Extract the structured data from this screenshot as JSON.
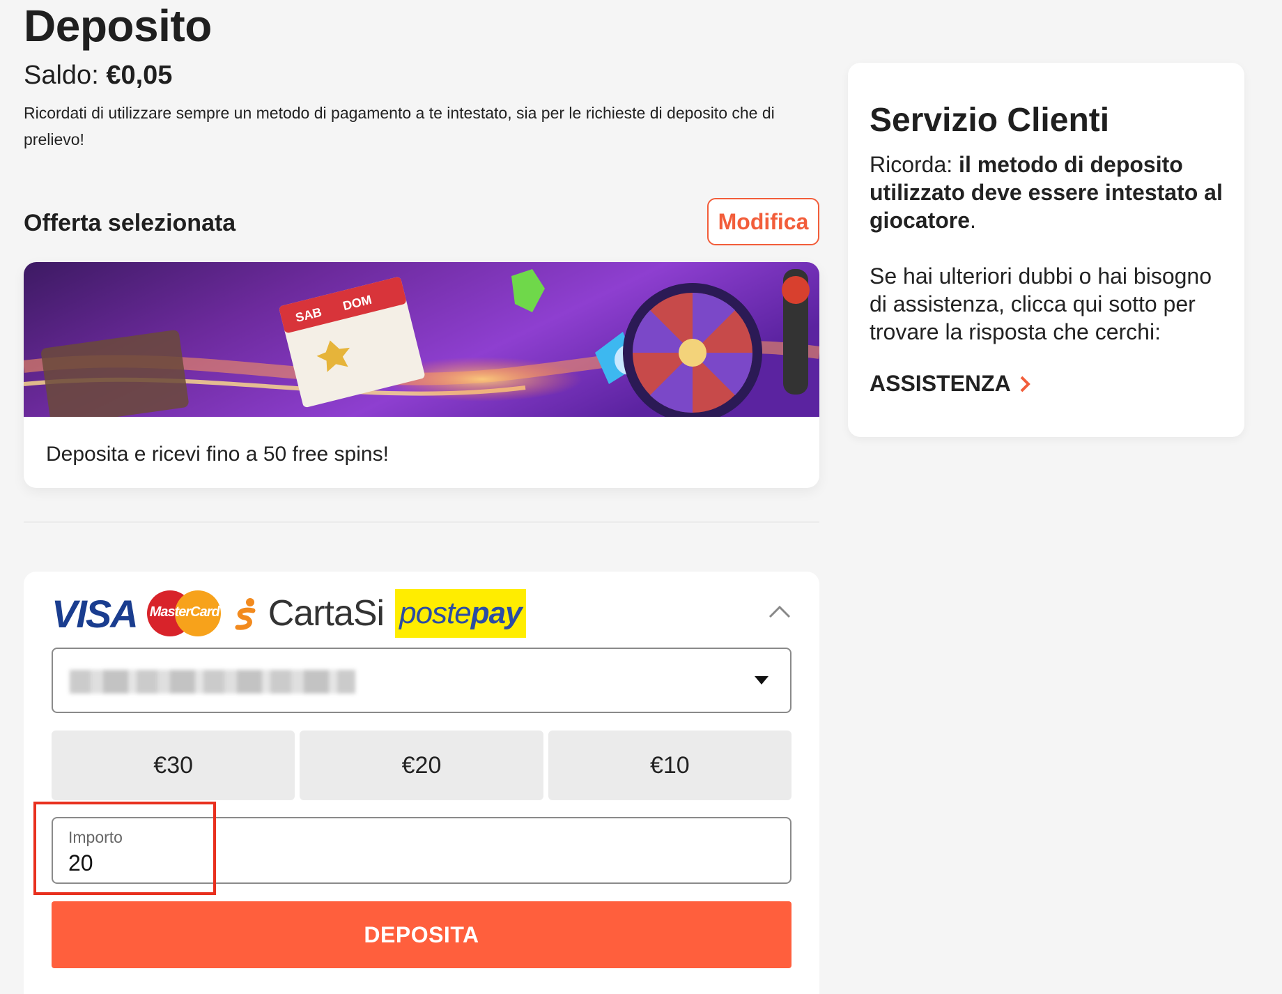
{
  "page": {
    "title": "Deposito",
    "balance_label": "Saldo:",
    "balance_value": "€0,05",
    "reminder": "Ricordati di utilizzare sempre un metodo di pagamento a te intestato, sia per le richieste di deposito che di prelievo!"
  },
  "offer": {
    "heading": "Offerta selezionata",
    "modify_label": "Modifica",
    "banner_calendar_days": [
      "SAB",
      "DOM"
    ],
    "description": "Deposita e ricevi fino a 50 free spins!"
  },
  "payment": {
    "logos": {
      "visa": "VISA",
      "mastercard": "MasterCard",
      "cartasi": "CartaSi",
      "postepay_a": "poste",
      "postepay_b": "pay"
    },
    "card_select_value": "",
    "amount_options": [
      "€30",
      "€20",
      "€10"
    ],
    "amount_label": "Importo",
    "amount_value": "20",
    "deposit_label": "DEPOSITA"
  },
  "support": {
    "title": "Servizio Clienti",
    "p1_prefix": "Ricorda: ",
    "p1_bold": "il metodo di deposito utilizzato deve essere intestato al giocatore",
    "p1_suffix": ".",
    "p2": "Se hai ulteriori dubbi o hai bisogno di assistenza, clicca qui sotto per trovare la risposta che cerchi:",
    "link_label": "ASSISTENZA"
  },
  "colors": {
    "accent": "#ff5f3d",
    "accent_border": "#f25d3a",
    "highlight": "#e8301e",
    "background": "#f5f5f5"
  },
  "icons": [
    "chevron-up-icon",
    "caret-down-icon",
    "chevron-right-icon"
  ]
}
